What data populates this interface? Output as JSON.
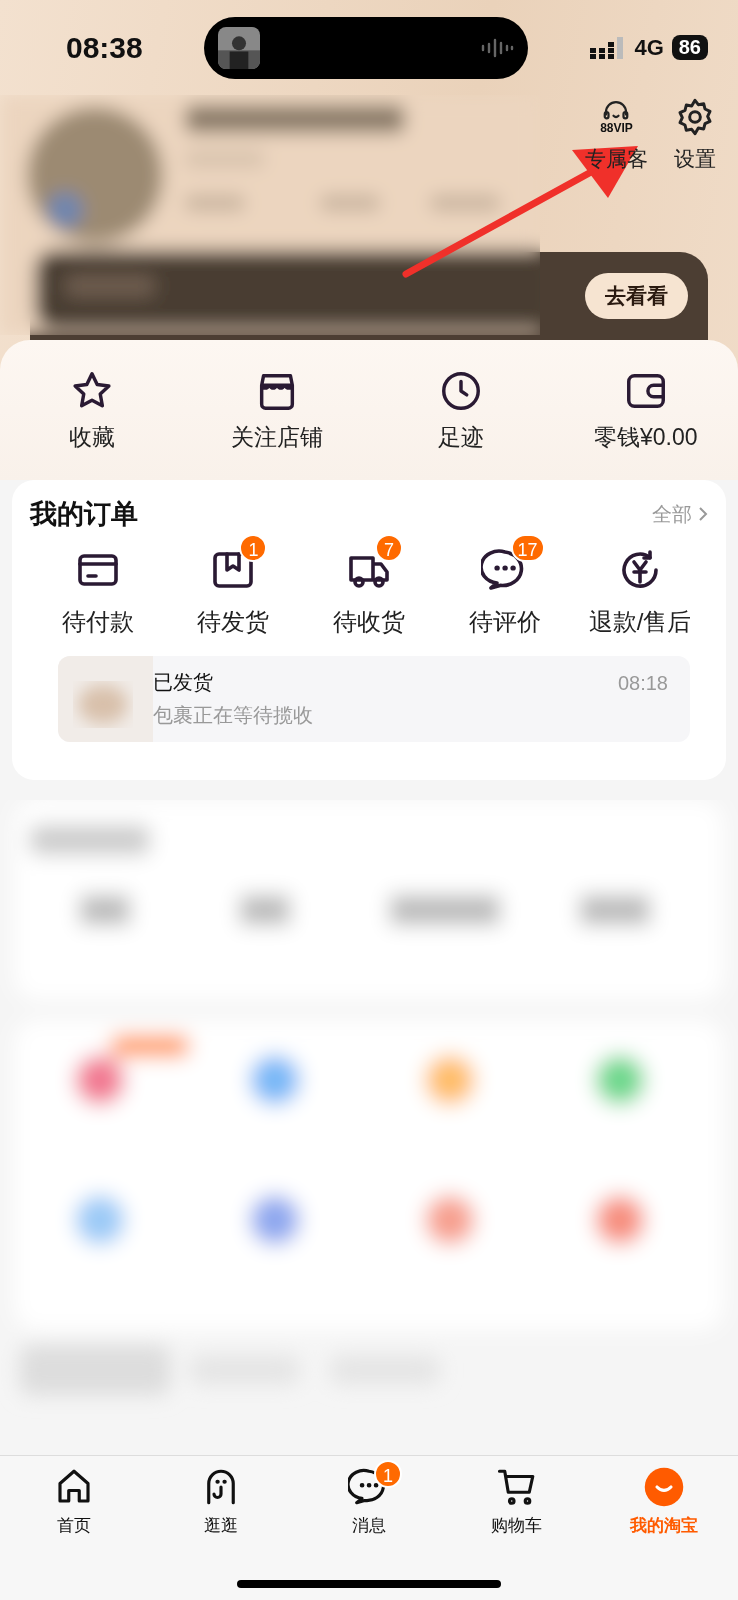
{
  "status_bar": {
    "time": "08:38",
    "network": "4G",
    "battery": "86"
  },
  "header": {
    "actions": [
      {
        "kind": "vip",
        "label": "专属客",
        "badge_text": "88VIP"
      },
      {
        "kind": "settings",
        "label": "设置"
      }
    ],
    "banner_button": "去看看"
  },
  "quick_links": [
    {
      "kind": "star",
      "label": "收藏"
    },
    {
      "kind": "shop",
      "label": "关注店铺"
    },
    {
      "kind": "clock",
      "label": "足迹"
    },
    {
      "kind": "wallet",
      "label": "零钱¥0.00"
    }
  ],
  "orders": {
    "title": "我的订单",
    "more": "全部",
    "items": [
      {
        "kind": "card",
        "label": "待付款"
      },
      {
        "kind": "box",
        "label": "待发货",
        "badge": "1"
      },
      {
        "kind": "truck",
        "label": "待收货",
        "badge": "7"
      },
      {
        "kind": "chat",
        "label": "待评价",
        "badge": "17"
      },
      {
        "kind": "refund",
        "label": "退款/售后"
      }
    ],
    "latest": {
      "title": "已发货",
      "subtitle": "包裹正在等待揽收",
      "time": "08:18"
    }
  },
  "tab_bar": [
    {
      "kind": "home",
      "label": "首页",
      "selected": false
    },
    {
      "kind": "ghost",
      "label": "逛逛",
      "selected": false
    },
    {
      "kind": "chat",
      "label": "消息",
      "badge": "1",
      "selected": false
    },
    {
      "kind": "cart",
      "label": "购物车",
      "selected": false
    },
    {
      "kind": "face",
      "label": "我的淘宝",
      "selected": true
    }
  ]
}
